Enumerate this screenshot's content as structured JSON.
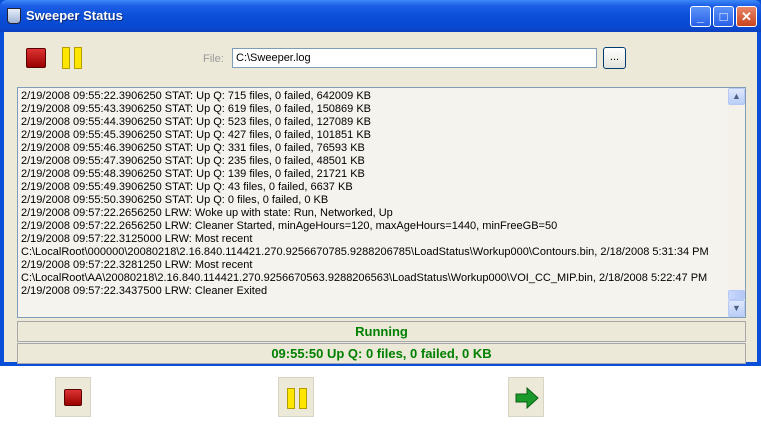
{
  "window": {
    "title": "Sweeper Status",
    "controls": {
      "minimize": "_",
      "maximize": "□",
      "close": "✕"
    }
  },
  "toolbar": {
    "file_label": "File:",
    "file_value": "C:\\Sweeper.log",
    "browse_label": "...",
    "stop_icon": "stop-icon",
    "pause_icon": "pause-icon"
  },
  "log": {
    "lines": [
      "2/19/2008 09:55:22.3906250 STAT: Up  Q: 715 files, 0 failed, 642009 KB",
      "2/19/2008 09:55:43.3906250 STAT: Up  Q: 619 files, 0 failed, 150869 KB",
      "2/19/2008 09:55:44.3906250 STAT: Up  Q: 523 files, 0 failed, 127089 KB",
      "2/19/2008 09:55:45.3906250 STAT: Up  Q: 427 files, 0 failed, 101851 KB",
      "2/19/2008 09:55:46.3906250 STAT: Up  Q: 331 files, 0 failed, 76593 KB",
      "2/19/2008 09:55:47.3906250 STAT: Up  Q: 235 files, 0 failed, 48501 KB",
      "2/19/2008 09:55:48.3906250 STAT: Up  Q: 139 files, 0 failed, 21721 KB",
      "2/19/2008 09:55:49.3906250 STAT: Up  Q: 43 files, 0 failed, 6637 KB",
      "2/19/2008 09:55:50.3906250 STAT: Up  Q: 0 files, 0 failed, 0 KB",
      "2/19/2008 09:57:22.2656250 LRW: Woke up with state: Run, Networked, Up",
      "2/19/2008 09:57:22.2656250 LRW: Cleaner Started,  minAgeHours=120, maxAgeHours=1440, minFreeGB=50",
      "2/19/2008 09:57:22.3125000 LRW: Most recent",
      "C:\\LocalRoot\\000000\\20080218\\2.16.840.114421.270.9256670785.9288206785\\LoadStatus\\Workup000\\Contours.bin, 2/18/2008 5:31:34 PM",
      "2/19/2008 09:57:22.3281250 LRW: Most recent",
      "C:\\LocalRoot\\AA\\20080218\\2.16.840.114421.270.9256670563.9288206563\\LoadStatus\\Workup000\\VOI_CC_MIP.bin, 2/18/2008 5:22:47 PM",
      "2/19/2008 09:57:22.3437500 LRW: Cleaner Exited"
    ]
  },
  "status": {
    "state": "Running",
    "summary": "09:55:50   Up  Q: 0 files, 0 failed, 0 KB",
    "color": "#008000"
  },
  "bottom_toolbar": {
    "stop_icon": "stop-icon",
    "pause_icon": "pause-icon",
    "go_icon": "go-arrow-icon"
  }
}
